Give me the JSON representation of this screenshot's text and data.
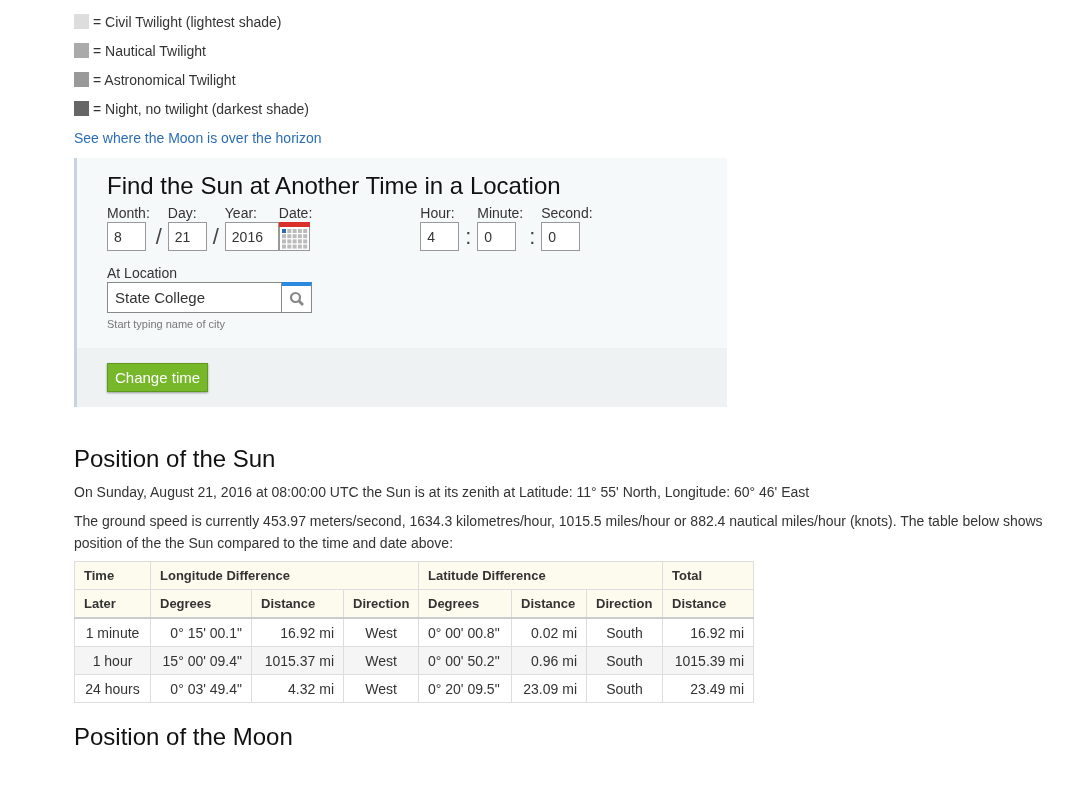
{
  "legend": [
    {
      "label": "= Civil Twilight (lightest shade)",
      "color": "#dddddd"
    },
    {
      "label": "= Nautical Twilight",
      "color": "#aaaaaa"
    },
    {
      "label": "= Astronomical Twilight",
      "color": "#999999"
    },
    {
      "label": "= Night, no twilight (darkest shade)",
      "color": "#666666"
    }
  ],
  "moon_link": "See where the Moon is over the horizon",
  "form": {
    "title": "Find the Sun at Another Time in a Location",
    "date_fields": [
      {
        "label": "Month:",
        "value": "8"
      },
      {
        "label": "Day:",
        "value": "21"
      },
      {
        "label": "Year:",
        "value": "2016"
      }
    ],
    "date_separators": [
      "/",
      "/"
    ],
    "date_picker_label": "Date:",
    "time_fields": [
      {
        "label": "Hour:",
        "value": "4"
      },
      {
        "label": "Minute:",
        "value": "0"
      },
      {
        "label": "Second:",
        "value": "0"
      }
    ],
    "time_separators": [
      ":",
      ":"
    ],
    "location_label": "At Location",
    "location_value": "State College",
    "location_hint": "Start typing name of city",
    "button": "Change time"
  },
  "sun_heading": "Position of the Sun",
  "zenith_text": "On Sunday, August 21, 2016 at 08:00:00 UTC the Sun is at its zenith at Latitude: 11° 55' North, Longitude: 60° 46' East",
  "speed_text": "The ground speed is currently 453.97 meters/second, 1634.3 kilometres/hour, 1015.5 miles/hour or 882.4 nautical miles/hour (knots). The table below shows position of the the Sun compared to the time and date above:",
  "table": {
    "column_groups": [
      {
        "label": "Time",
        "columns": [
          "Later"
        ]
      },
      {
        "label": "Longitude Difference",
        "columns": [
          "Degrees",
          "Distance",
          "Direction"
        ]
      },
      {
        "label": "Latitude Difference",
        "columns": [
          "Degrees",
          "Distance",
          "Direction"
        ]
      },
      {
        "label": "Total",
        "columns": [
          "Distance"
        ]
      }
    ],
    "rows": [
      [
        "1 minute",
        "0° 15' 00.1\"",
        "16.92 mi",
        "West",
        "0° 00' 00.8\"",
        "0.02 mi",
        "South",
        "16.92 mi"
      ],
      [
        "1 hour",
        "15° 00' 09.4\"",
        "1015.37 mi",
        "West",
        "0° 00' 50.2\"",
        "0.96 mi",
        "South",
        "1015.39 mi"
      ],
      [
        "24 hours",
        "0° 03' 49.4\"",
        "4.32 mi",
        "West",
        "0° 20' 09.5\"",
        "23.09 mi",
        "South",
        "23.49 mi"
      ]
    ]
  },
  "moon_heading": "Position of the Moon"
}
